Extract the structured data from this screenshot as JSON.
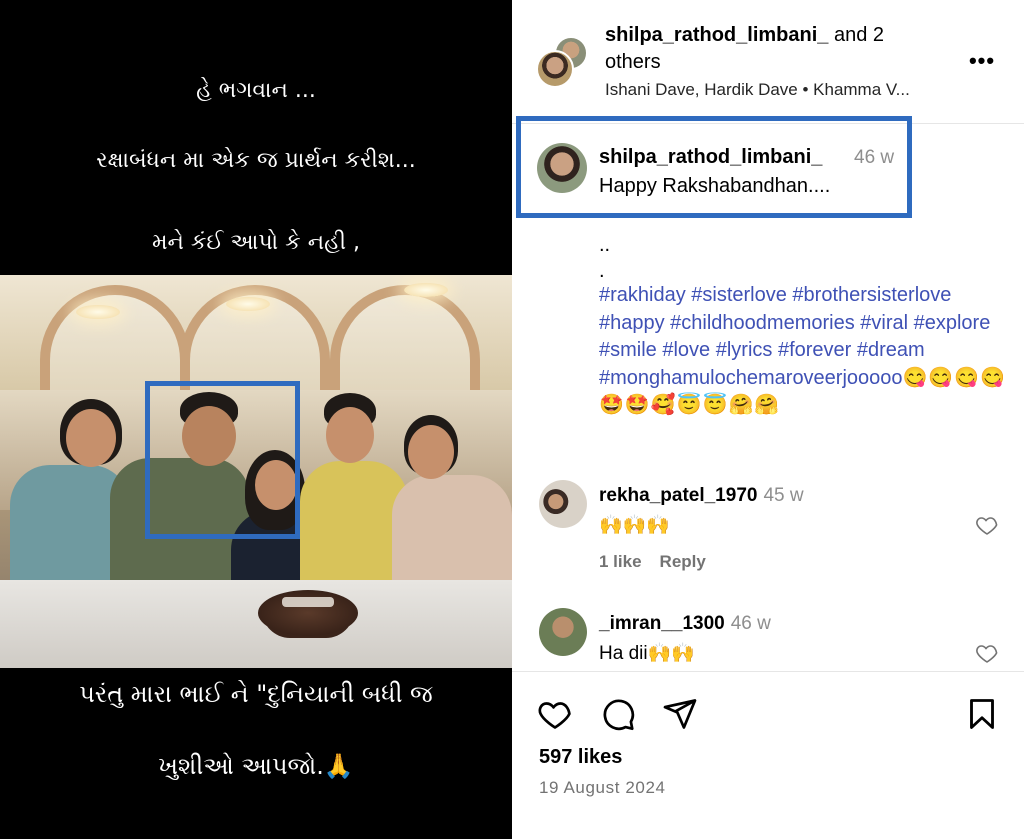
{
  "media": {
    "lines": [
      "હે ભગવાન ...",
      "રક્ષાબંધન મા એક જ પ્રાર્થન કરીશ...",
      "મને કંઈ આપો કે નહી ,",
      "પરંતુ મારા ભાઈ ને \"દુનિયાની બધી જ",
      "ખુશીઓ આપજો.🙏"
    ]
  },
  "header": {
    "title_user": "shilpa_rathod_limbani_",
    "title_rest": " and 2 others",
    "subtitle": "Ishani Dave, Hardik Dave • Khamma V...",
    "more_label": "•••"
  },
  "caption": {
    "username": "shilpa_rathod_limbani_",
    "time": "46 w",
    "text": "Happy Rakshabandhan....",
    "dots": "..",
    "dot": ".",
    "hashtags": "#rakhiday #sisterlove #brothersisterlove #happy #childhoodmemories #viral #explore #smile #love #lyrics #forever #dream #monghamulochemaroveerjooooo",
    "emojis": "😋😋😋😋🤩🤩🥰😇😇🤗🤗"
  },
  "comments": [
    {
      "username": "rekha_patel_1970",
      "time": "45 w",
      "text": "🙌🙌🙌",
      "likes": "1 like",
      "reply": "Reply"
    },
    {
      "username": "_imran__1300",
      "time": "46 w",
      "text": "Ha dii",
      "emoji": "🙌🙌"
    }
  ],
  "footer": {
    "likes": "597 likes",
    "date": "19 August 2024"
  },
  "icons": [
    "heart-icon",
    "comment-icon",
    "share-icon",
    "bookmark-icon",
    "more-icon"
  ]
}
